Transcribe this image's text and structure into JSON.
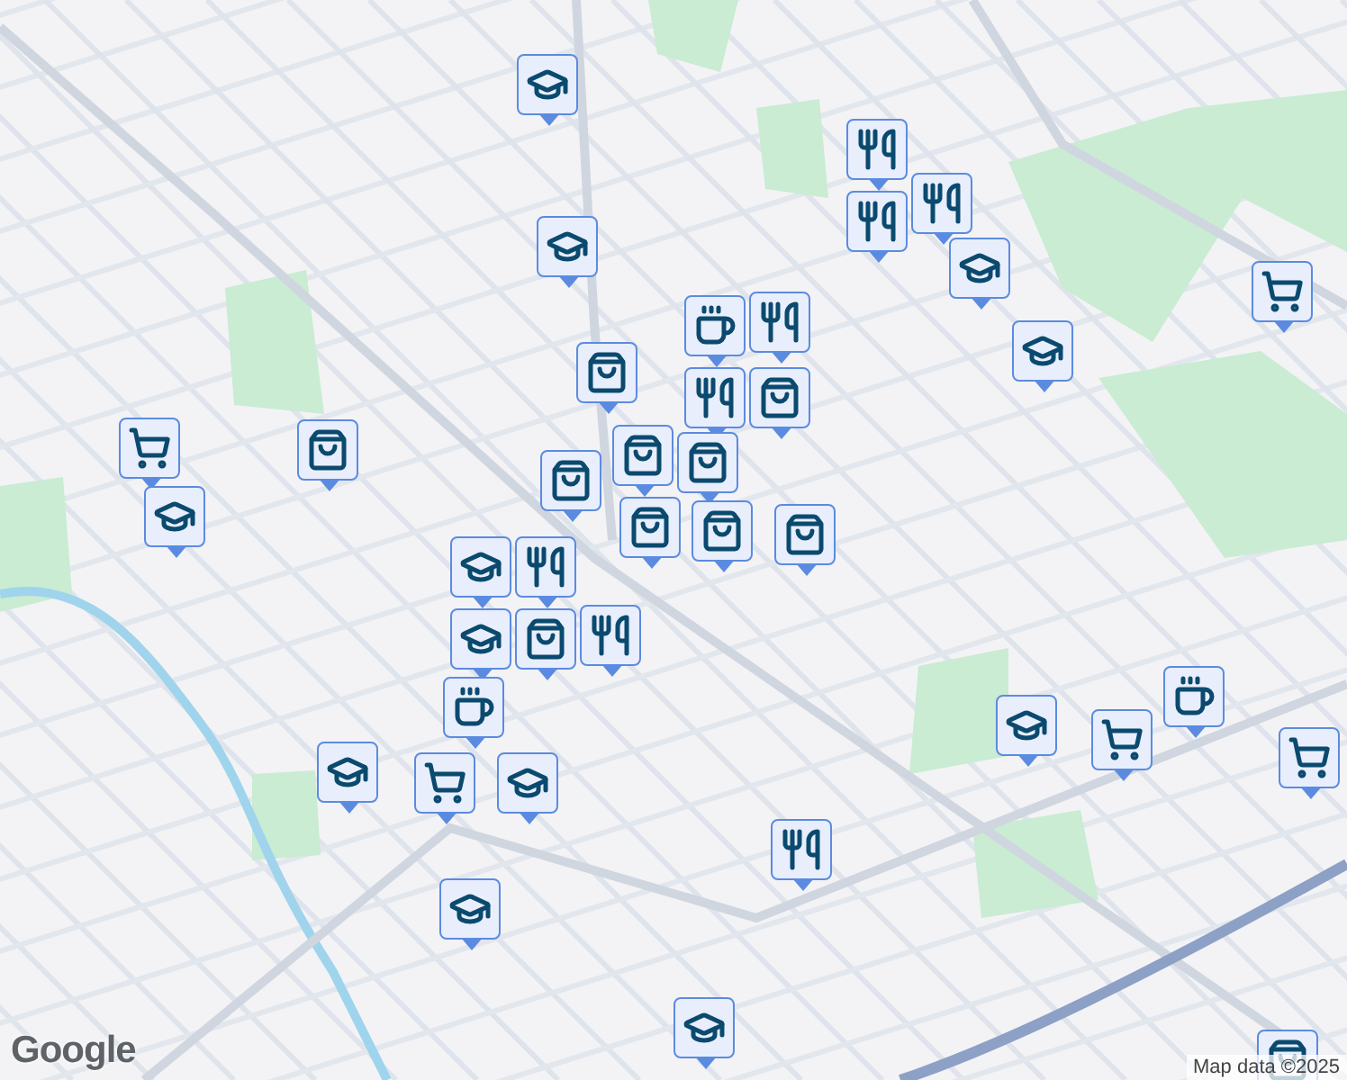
{
  "markers": [
    {
      "kind": "school"
    },
    {
      "kind": "food"
    },
    {
      "kind": "food"
    },
    {
      "kind": "food"
    },
    {
      "kind": "school"
    },
    {
      "kind": "grocery"
    },
    {
      "kind": "school"
    },
    {
      "kind": "school"
    },
    {
      "kind": "cafe"
    },
    {
      "kind": "food"
    },
    {
      "kind": "shopping"
    },
    {
      "kind": "food"
    },
    {
      "kind": "shopping"
    },
    {
      "kind": "shopping"
    },
    {
      "kind": "shopping"
    },
    {
      "kind": "shopping"
    },
    {
      "kind": "shopping"
    },
    {
      "kind": "shopping"
    },
    {
      "kind": "shopping"
    },
    {
      "kind": "shopping"
    },
    {
      "kind": "grocery"
    },
    {
      "kind": "school"
    },
    {
      "kind": "school"
    },
    {
      "kind": "food"
    },
    {
      "kind": "school"
    },
    {
      "kind": "shopping"
    },
    {
      "kind": "food"
    },
    {
      "kind": "cafe"
    },
    {
      "kind": "grocery"
    },
    {
      "kind": "school"
    },
    {
      "kind": "school"
    },
    {
      "kind": "school"
    },
    {
      "kind": "grocery"
    },
    {
      "kind": "cafe"
    },
    {
      "kind": "grocery"
    },
    {
      "kind": "food"
    },
    {
      "kind": "school"
    },
    {
      "kind": "school"
    },
    {
      "kind": "shopping"
    }
  ],
  "logo": "Google",
  "attribution": "Map data ©2025"
}
